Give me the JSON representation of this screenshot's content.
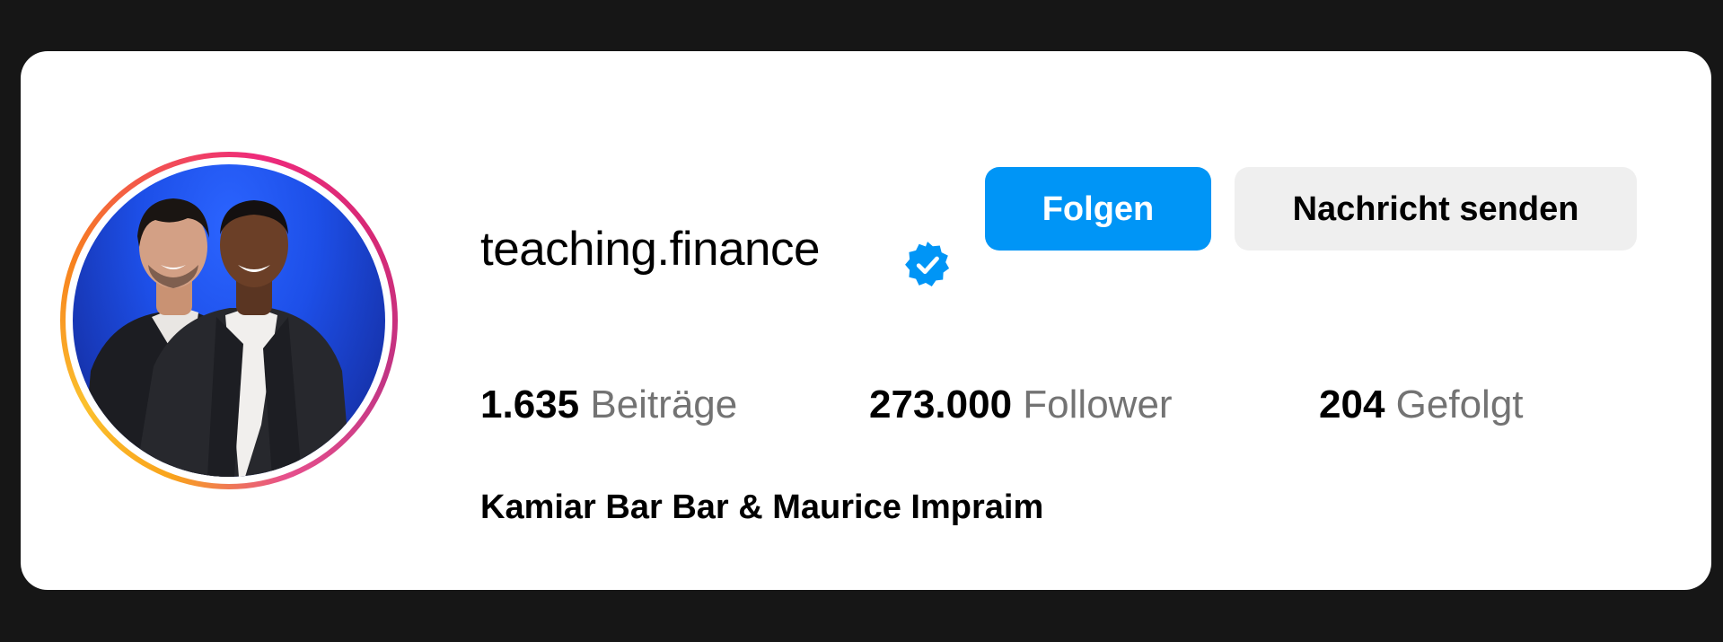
{
  "profile": {
    "username": "teaching.finance",
    "full_name": "Kamiar Bar Bar & Maurice Impraim",
    "verified": true
  },
  "actions": {
    "follow_label": "Folgen",
    "message_label": "Nachricht senden"
  },
  "stats": {
    "posts": {
      "value": "1.635",
      "label": "Beiträge"
    },
    "followers": {
      "value": "273.000",
      "label": "Follower"
    },
    "following": {
      "value": "204",
      "label": "Gefolgt"
    }
  },
  "icons": {
    "verified_badge": "verified-badge-icon",
    "avatar": "profile-photo"
  },
  "colors": {
    "page_background": "#161616",
    "card_background": "#ffffff",
    "follow_button": "#0095f6",
    "message_button": "#efefef",
    "verified_badge": "#0095f6",
    "secondary_text": "#737373"
  }
}
